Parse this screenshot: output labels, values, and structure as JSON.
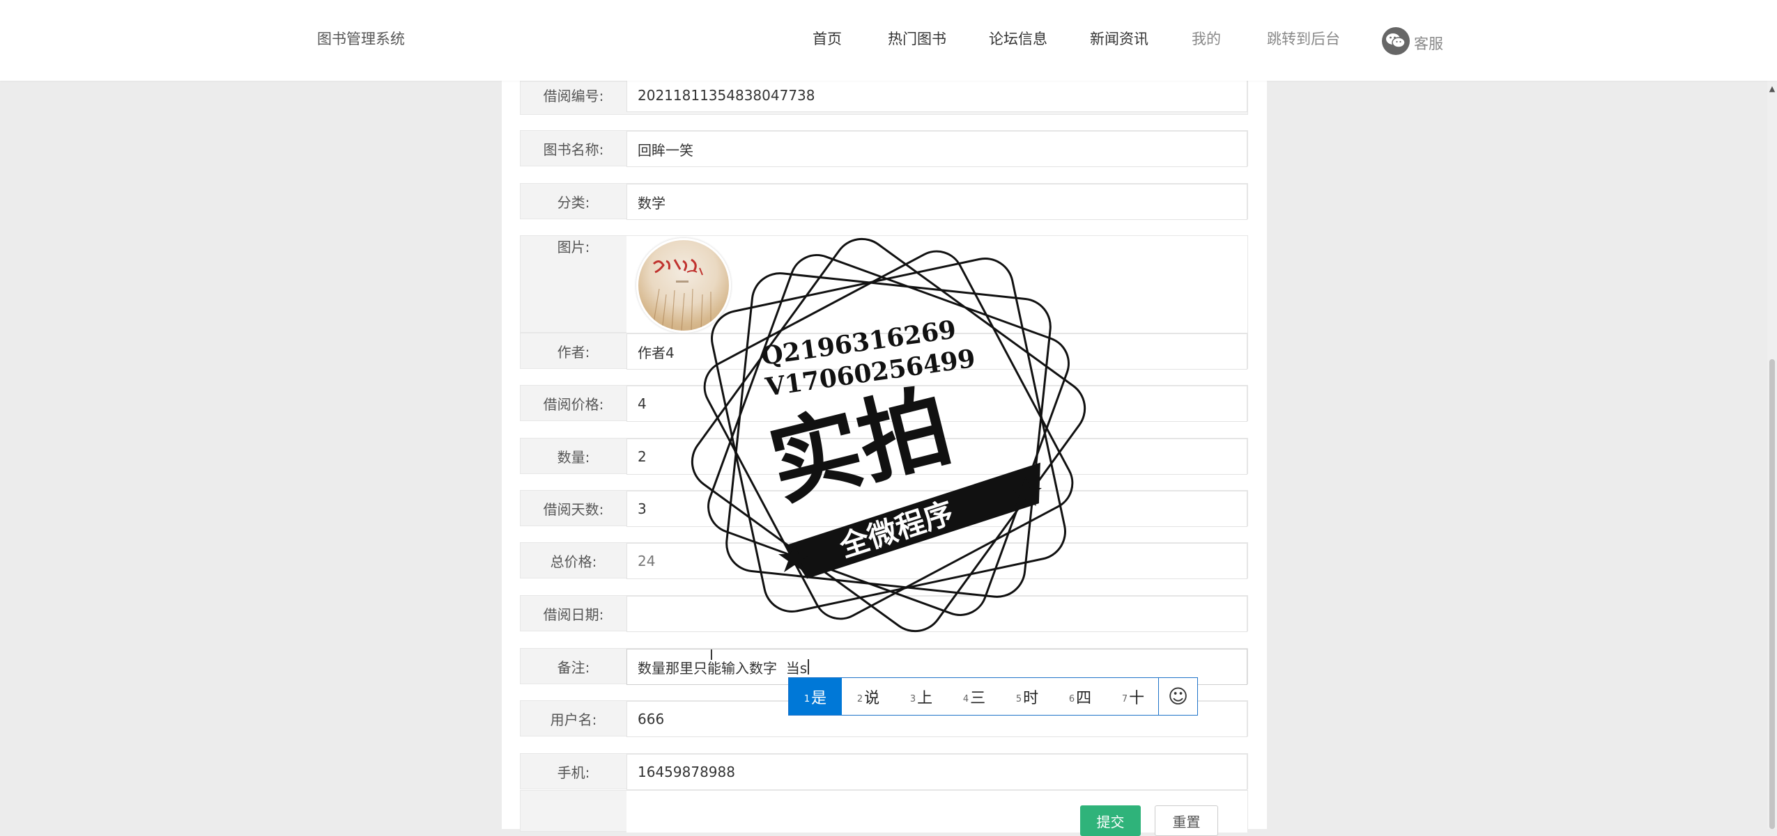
{
  "header": {
    "brand": "图书管理系统",
    "nav": [
      "首页",
      "热门图书",
      "论坛信息",
      "新闻资讯",
      "我的",
      "跳转到后台"
    ],
    "service_label": "客服",
    "service_icon": "wechat-icon"
  },
  "form": {
    "borrow_no": {
      "label": "借阅编号:",
      "value": "20211811354838047738"
    },
    "book_name": {
      "label": "图书名称:",
      "value": "回眸一笑"
    },
    "category": {
      "label": "分类:",
      "value": "数学"
    },
    "image": {
      "label": "图片:"
    },
    "author": {
      "label": "作者:",
      "value": "作者4"
    },
    "borrow_price": {
      "label": "借阅价格:",
      "value": "4"
    },
    "quantity": {
      "label": "数量:",
      "value": "2"
    },
    "borrow_days": {
      "label": "借阅天数:",
      "value": "3"
    },
    "total_price": {
      "label": "总价格:",
      "value": "24"
    },
    "borrow_date": {
      "label": "借阅日期:",
      "value": ""
    },
    "remark": {
      "label": "备注:",
      "value": "数量那里只能输入数字  当s"
    },
    "username": {
      "label": "用户名:",
      "value": "666"
    },
    "phone": {
      "label": "手机:",
      "value": "16459878988"
    }
  },
  "buttons": {
    "submit": "提交",
    "reset": "重置"
  },
  "ime": {
    "candidates": [
      {
        "num": "1",
        "text": "是"
      },
      {
        "num": "2",
        "text": "说"
      },
      {
        "num": "3",
        "text": "上"
      },
      {
        "num": "4",
        "text": "三"
      },
      {
        "num": "5",
        "text": "时"
      },
      {
        "num": "6",
        "text": "四"
      },
      {
        "num": "7",
        "text": "十"
      }
    ],
    "emoji": "☺"
  },
  "watermark": {
    "line1": "Q2196316269",
    "line2": "V17060256499",
    "title": "实拍",
    "ribbon": "全微程序"
  },
  "colors": {
    "primary": "#2fb37a",
    "ime_blue": "#0078d7",
    "background": "#ececec"
  }
}
